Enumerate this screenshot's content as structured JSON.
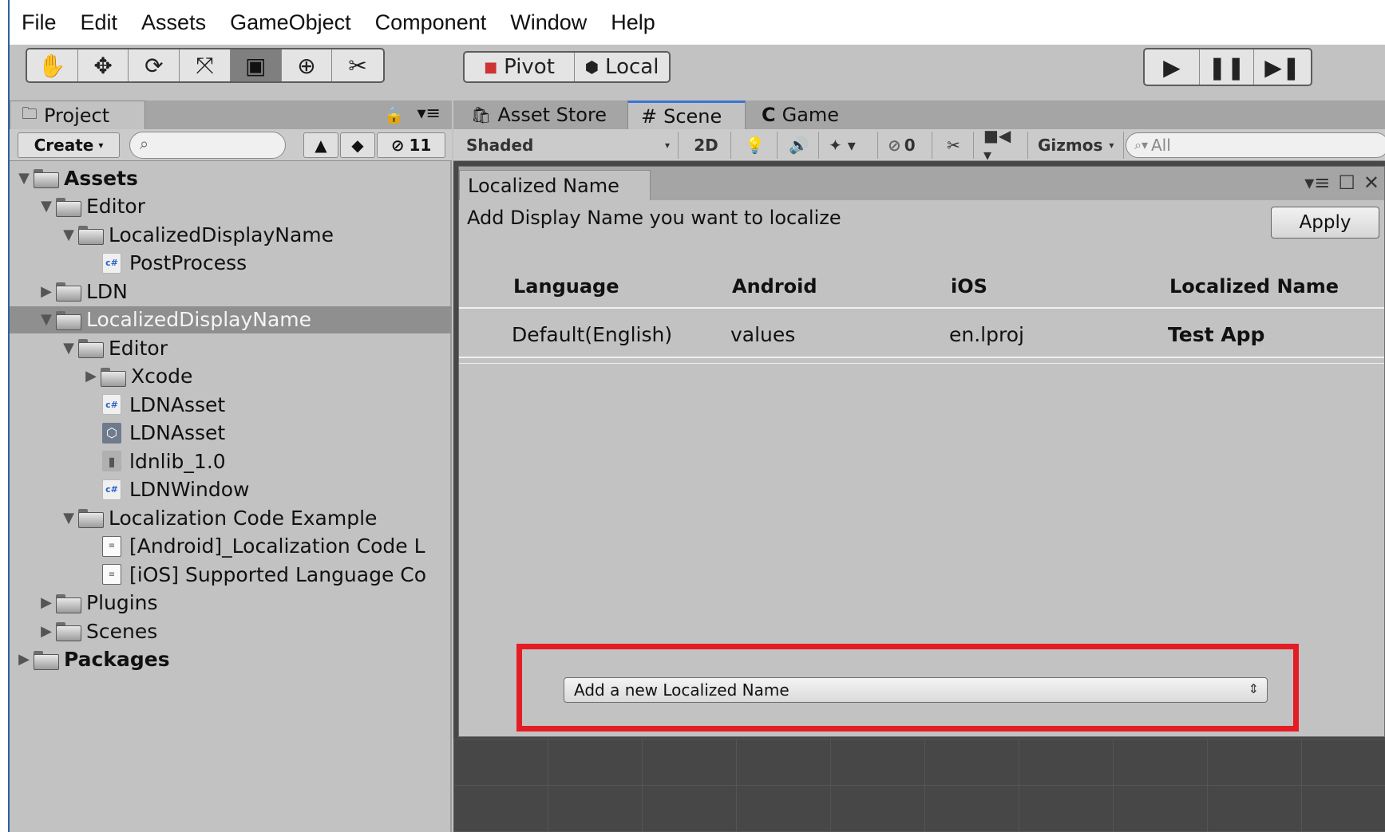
{
  "menubar": {
    "items": [
      "File",
      "Edit",
      "Assets",
      "GameObject",
      "Component",
      "Window",
      "Help"
    ]
  },
  "toolbar": {
    "transform_tools": [
      "hand-icon",
      "move-icon",
      "rotate-icon",
      "scale-icon",
      "rect-icon",
      "transform-icon",
      "custom-tool-icon"
    ],
    "pivot_label": "Pivot",
    "local_label": "Local",
    "play_icons": [
      "play-icon",
      "pause-icon",
      "step-icon"
    ]
  },
  "project": {
    "tab_label": "Project",
    "create_label": "Create",
    "hidden_count": "11",
    "tree": [
      {
        "label": "Assets",
        "depth": 0,
        "kind": "folder",
        "expanded": true,
        "bold": true
      },
      {
        "label": "Editor",
        "depth": 1,
        "kind": "folder",
        "expanded": true
      },
      {
        "label": "LocalizedDisplayName",
        "depth": 2,
        "kind": "folder",
        "expanded": true
      },
      {
        "label": "PostProcess",
        "depth": 3,
        "kind": "cs"
      },
      {
        "label": "LDN",
        "depth": 1,
        "kind": "folder",
        "expanded": false
      },
      {
        "label": "LocalizedDisplayName",
        "depth": 1,
        "kind": "folder",
        "expanded": true,
        "selected": true
      },
      {
        "label": "Editor",
        "depth": 2,
        "kind": "folder",
        "expanded": true
      },
      {
        "label": "Xcode",
        "depth": 3,
        "kind": "folder",
        "expanded": false
      },
      {
        "label": "LDNAsset",
        "depth": 3,
        "kind": "cs"
      },
      {
        "label": "LDNAsset",
        "depth": 3,
        "kind": "asset"
      },
      {
        "label": "ldnlib_1.0",
        "depth": 3,
        "kind": "dll"
      },
      {
        "label": "LDNWindow",
        "depth": 3,
        "kind": "cs"
      },
      {
        "label": "Localization Code Example",
        "depth": 2,
        "kind": "folder",
        "expanded": true
      },
      {
        "label": "[Android]_Localization Code L",
        "depth": 3,
        "kind": "txt"
      },
      {
        "label": "[iOS] Supported Language Co",
        "depth": 3,
        "kind": "txt"
      },
      {
        "label": "Plugins",
        "depth": 1,
        "kind": "folder",
        "expanded": false
      },
      {
        "label": "Scenes",
        "depth": 1,
        "kind": "folder",
        "expanded": false
      },
      {
        "label": "Packages",
        "depth": 0,
        "kind": "folder",
        "expanded": false,
        "bold": true
      }
    ]
  },
  "scene": {
    "tabs": [
      "Asset Store",
      "Scene",
      "Game"
    ],
    "active_tab": "Scene",
    "shading_label": "Shaded",
    "mode_2d_label": "2D",
    "hidden_count": "0",
    "gizmos_label": "Gizmos",
    "search_placeholder": "All"
  },
  "ldn_window": {
    "tab_label": "Localized Name",
    "description": "Add Display Name you want to localize",
    "apply_label": "Apply",
    "columns": [
      "Language",
      "Android",
      "iOS",
      "Localized Name"
    ],
    "rows": [
      [
        "Default(English)",
        "values",
        "en.lproj",
        "Test App"
      ]
    ],
    "add_select_value": "Add a new Localized Name"
  },
  "colors": {
    "highlight": "#e41c23",
    "accent": "#3a72d8",
    "panel_bg": "#c2c2c2",
    "scene_bg": "#474747"
  }
}
